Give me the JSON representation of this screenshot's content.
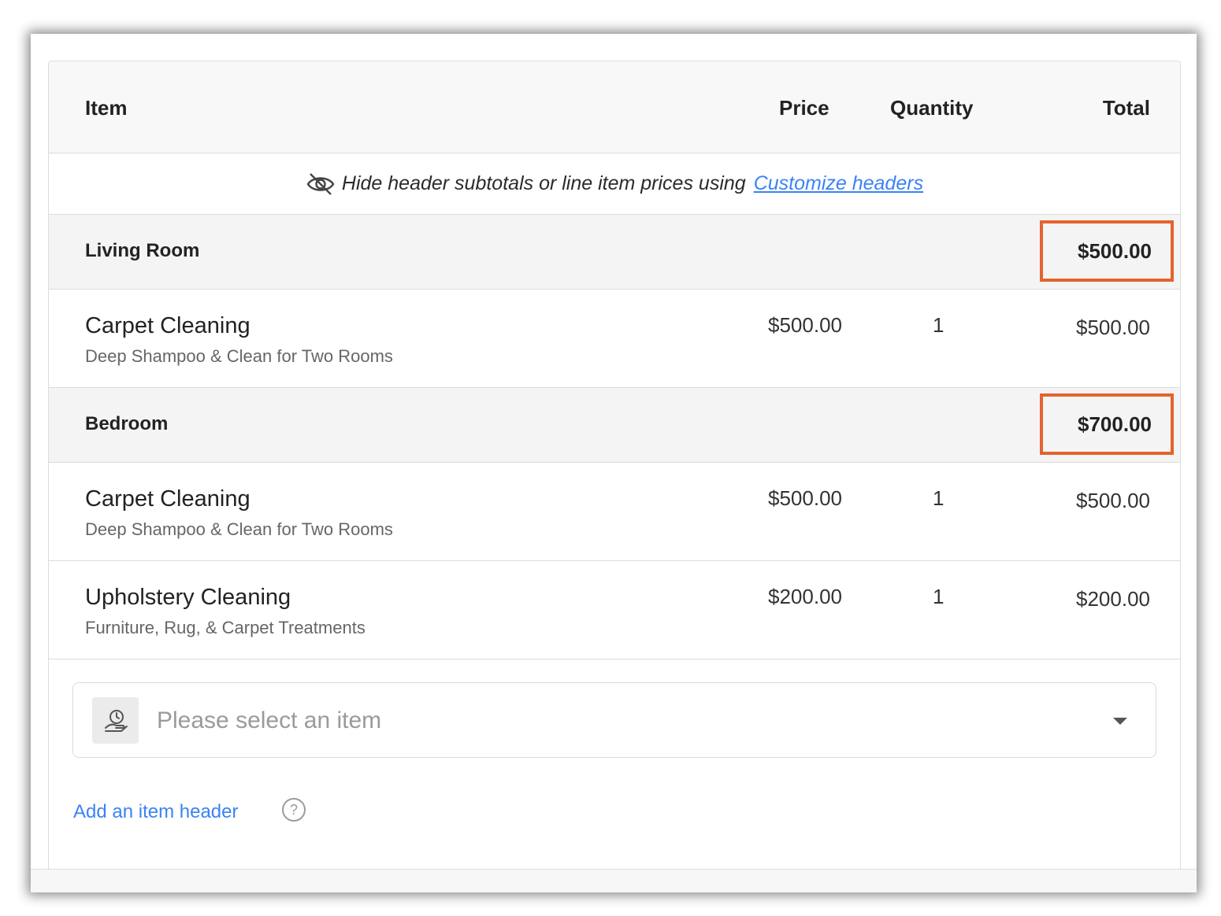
{
  "table": {
    "headers": {
      "item": "Item",
      "price": "Price",
      "quantity": "Quantity",
      "total": "Total"
    },
    "hint": {
      "icon": "eye-slash-icon",
      "text": "Hide header subtotals or line item prices using",
      "link": "Customize headers"
    },
    "groups": [
      {
        "name": "Living Room",
        "total": "$500.00",
        "items": [
          {
            "name": "Carpet Cleaning",
            "description": "Deep Shampoo & Clean for Two Rooms",
            "price": "$500.00",
            "quantity": "1",
            "total": "$500.00"
          }
        ]
      },
      {
        "name": "Bedroom",
        "total": "$700.00",
        "items": [
          {
            "name": "Carpet Cleaning",
            "description": "Deep Shampoo & Clean for Two Rooms",
            "price": "$500.00",
            "quantity": "1",
            "total": "$500.00"
          },
          {
            "name": "Upholstery Cleaning",
            "description": "Furniture, Rug, & Carpet Treatments",
            "price": "$200.00",
            "quantity": "1",
            "total": "$200.00"
          }
        ]
      }
    ]
  },
  "selector": {
    "placeholder": "Please select an item",
    "icon": "service-hand-icon",
    "caret_icon": "caret-down-icon"
  },
  "add_header": {
    "label": "Add an item header",
    "help_symbol": "?",
    "help_icon": "help-circle-icon"
  },
  "colors": {
    "highlight": "#e4632e",
    "link": "#3b82f6",
    "group_bg": "#f4f4f4"
  }
}
